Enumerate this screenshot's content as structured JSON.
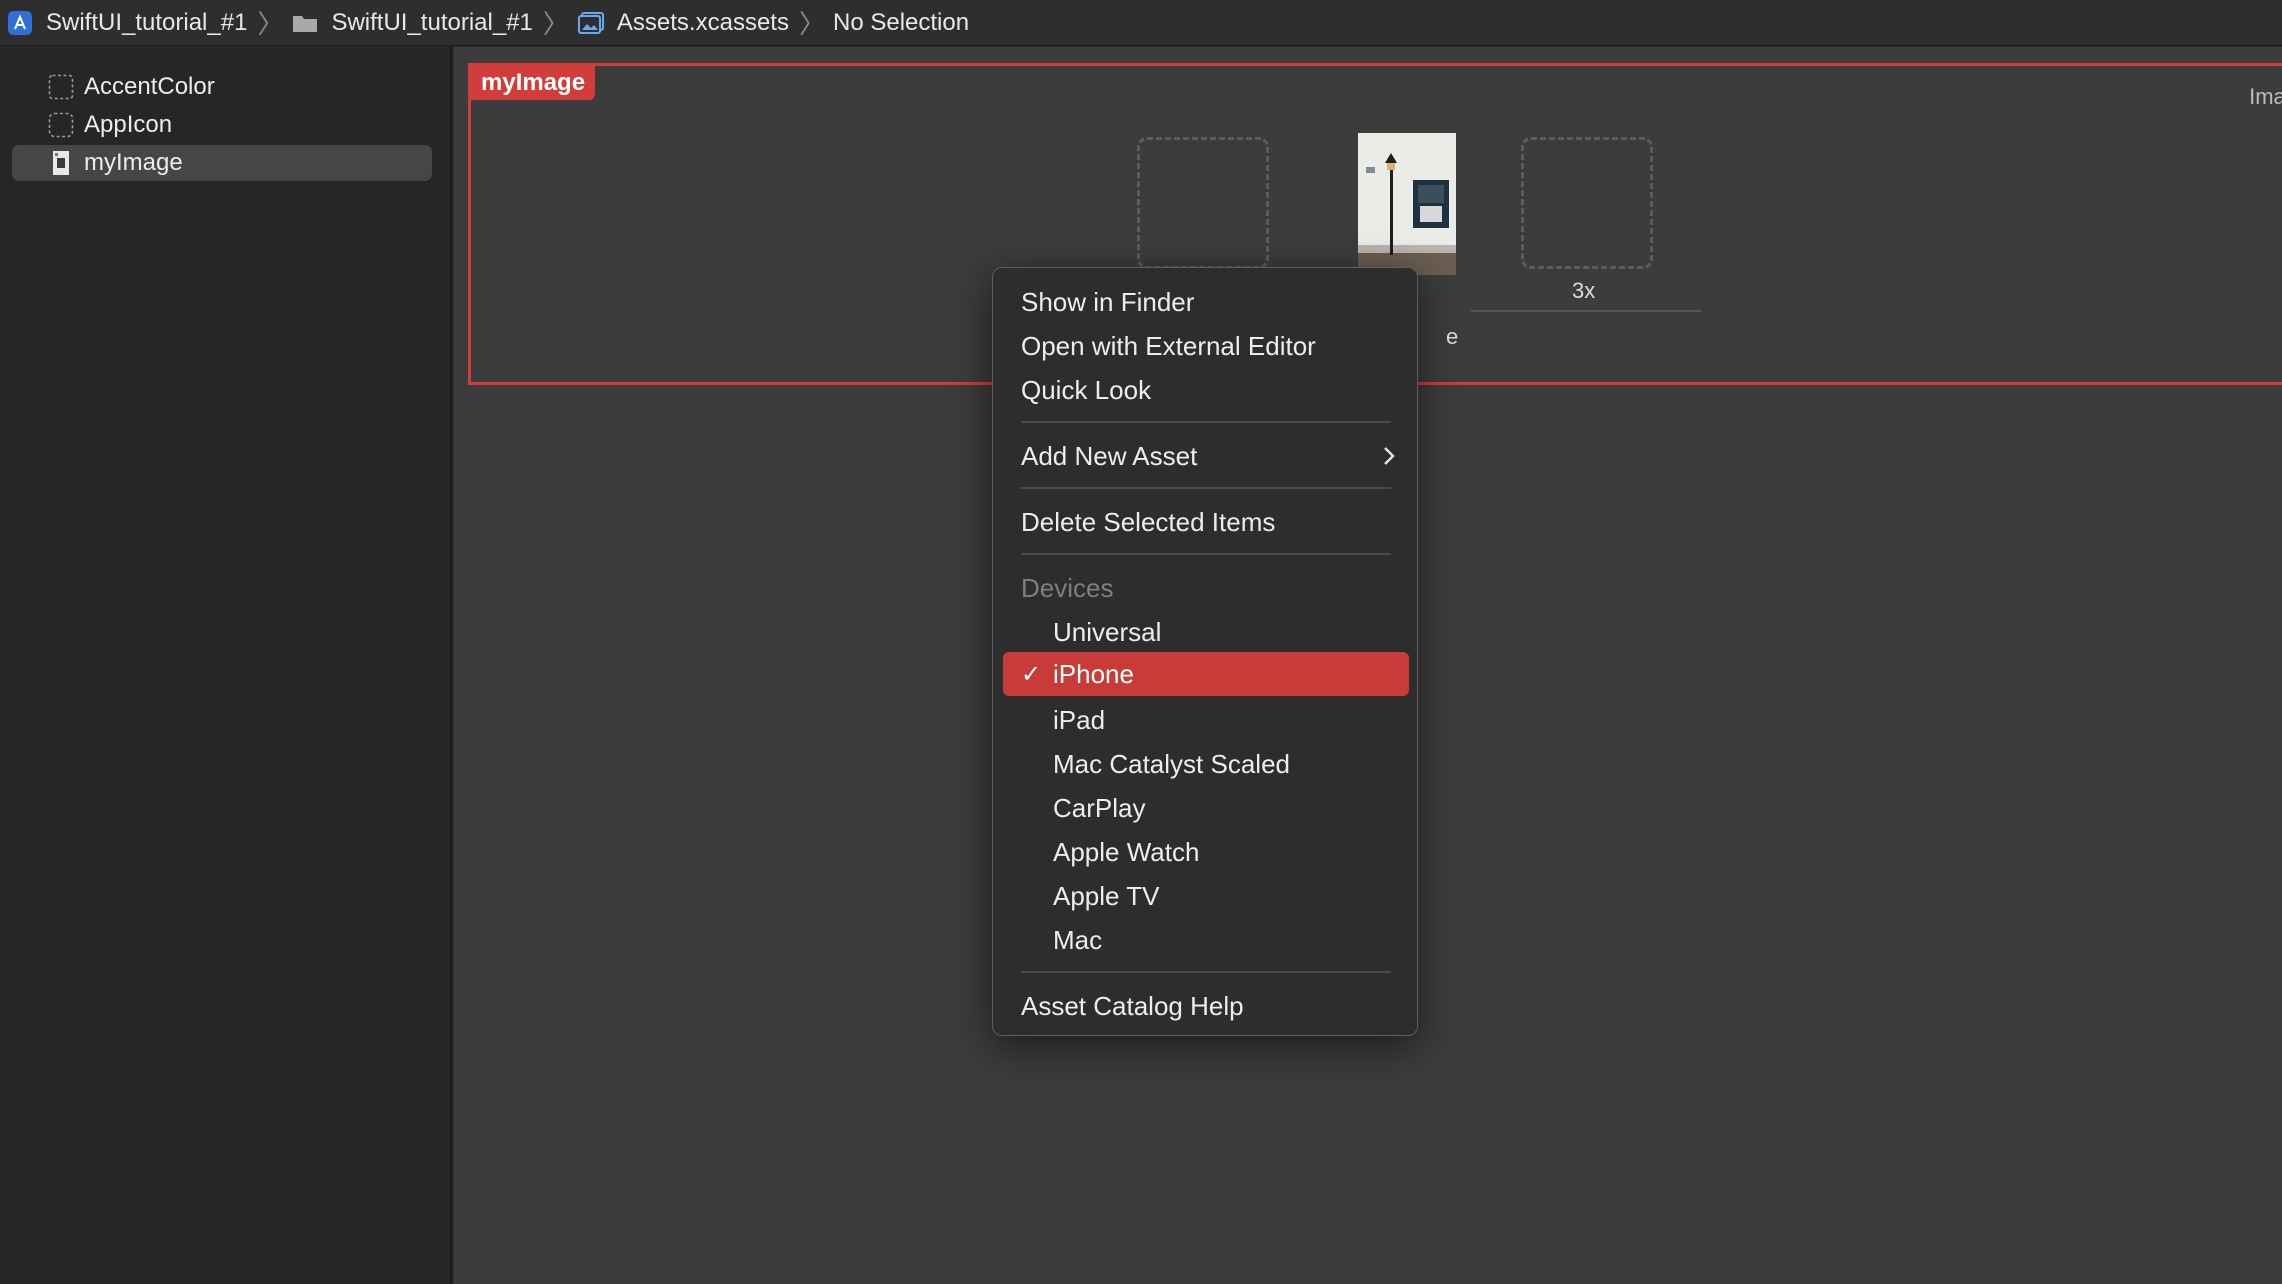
{
  "breadcrumb": {
    "project": "SwiftUI_tutorial_#1",
    "folder": "SwiftUI_tutorial_#1",
    "catalog": "Assets.xcassets",
    "selection": "No Selection"
  },
  "sidebar": {
    "items": [
      {
        "label": "AccentColor",
        "icon": "color-set-icon"
      },
      {
        "label": "AppIcon",
        "icon": "app-icon-set-icon"
      },
      {
        "label": "myImage",
        "icon": "image-set-icon",
        "selected": true
      }
    ]
  },
  "asset": {
    "name": "myImage",
    "right_label": "Imag",
    "slot_3x_label": "3x",
    "partial_label": "e"
  },
  "context_menu": {
    "show_in_finder": "Show in Finder",
    "open_external": "Open with External Editor",
    "quick_look": "Quick Look",
    "add_new_asset": "Add New Asset",
    "delete_selected": "Delete Selected Items",
    "devices_header": "Devices",
    "devices": [
      "Universal",
      "iPhone",
      "iPad",
      "Mac Catalyst Scaled",
      "CarPlay",
      "Apple Watch",
      "Apple TV",
      "Mac"
    ],
    "selected_device": "iPhone",
    "check_glyph": "✓",
    "help": "Asset Catalog Help"
  },
  "colors": {
    "accent_red": "#d23c3a",
    "menu_highlight": "#c93b39",
    "background": "#3c3c3c"
  }
}
